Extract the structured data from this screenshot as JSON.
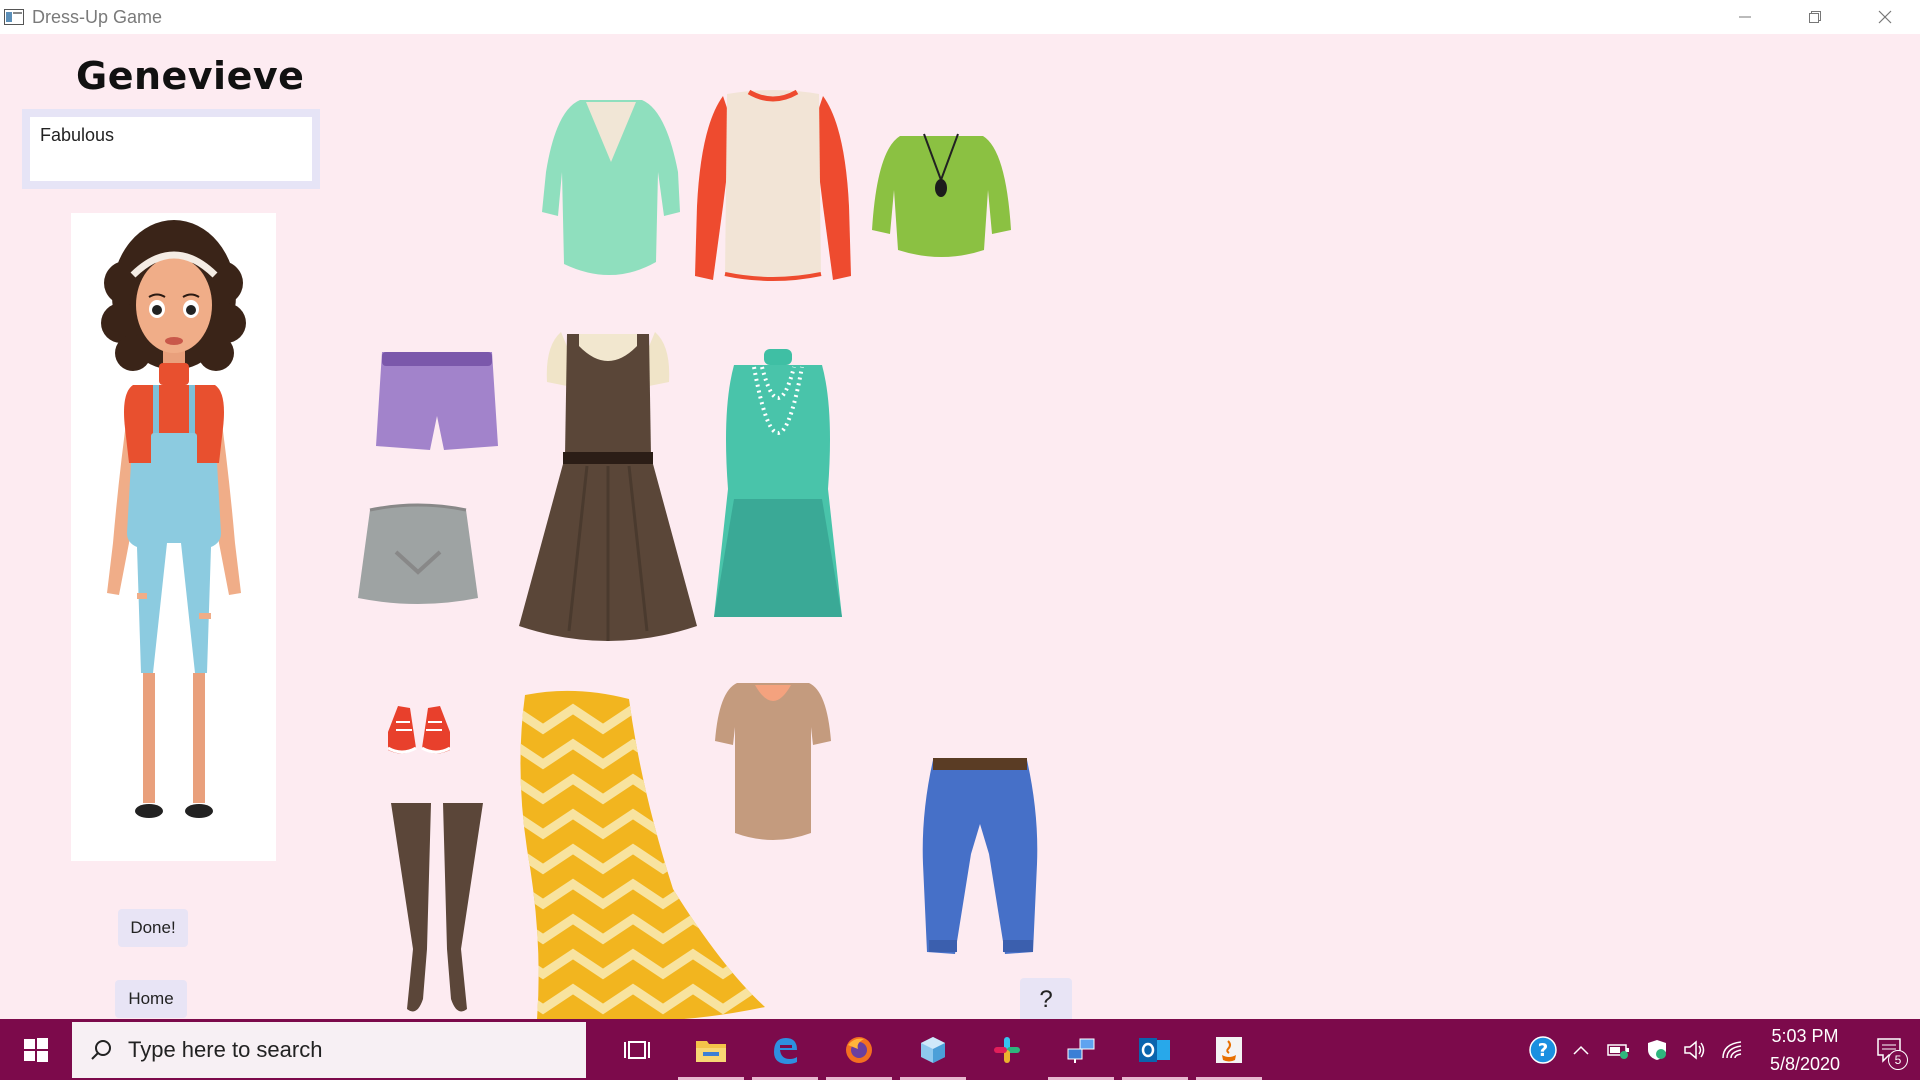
{
  "window": {
    "title": "Dress-Up Game"
  },
  "app": {
    "player_name": "Genevieve",
    "status_text": "Fabulous",
    "done_label": "Done!",
    "home_label": "Home",
    "help_label": "?"
  },
  "wardrobe": [
    "mint-v-neck-top",
    "red-sleeve-tee",
    "green-top-with-necklace",
    "purple-shorts",
    "brown-dress",
    "teal-dress-with-pearls",
    "gray-skirt",
    "red-sneakers",
    "brown-boots",
    "yellow-chevron-maxi-skirt",
    "tan-top",
    "blue-capri-jeans"
  ],
  "taskbar": {
    "search_placeholder": "Type here to search",
    "time": "5:03 PM",
    "date": "5/8/2020",
    "notification_count": "5"
  }
}
